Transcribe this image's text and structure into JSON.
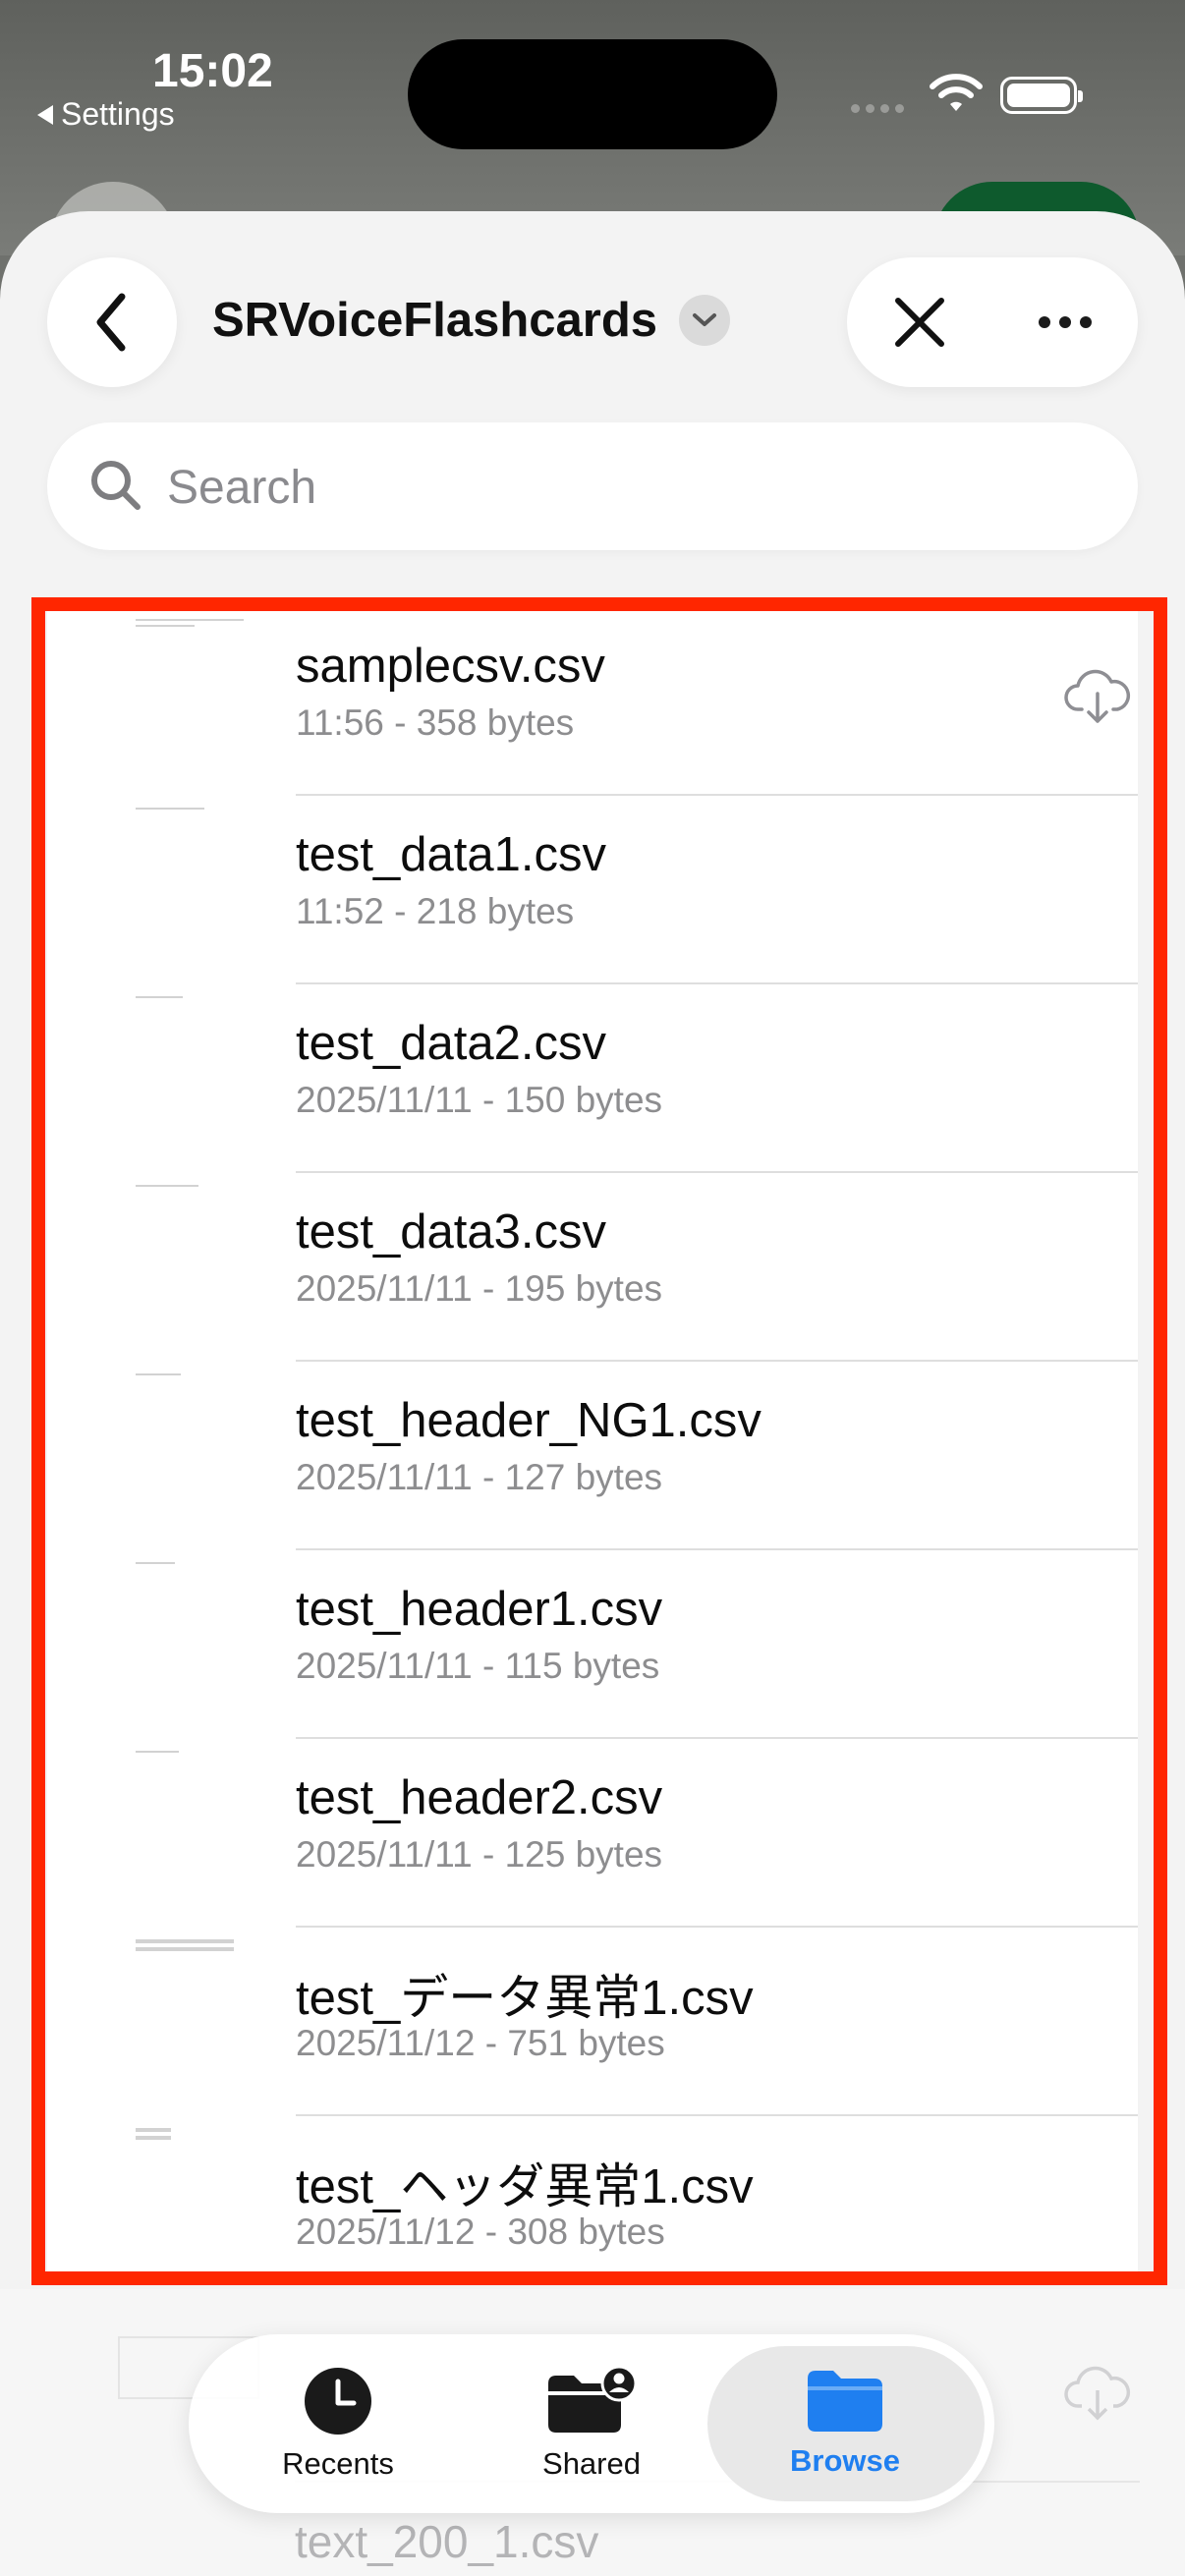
{
  "status_bar": {
    "time": "15:02",
    "back_label": "Settings"
  },
  "header": {
    "title": "SRVoiceFlashcards"
  },
  "search": {
    "placeholder": "Search",
    "value": ""
  },
  "files": [
    {
      "name": "samplecsv.csv",
      "meta": "11:56 - 358 bytes",
      "cloud": true
    },
    {
      "name": "test_data1.csv",
      "meta": "11:52 - 218 bytes",
      "cloud": false
    },
    {
      "name": "test_data2.csv",
      "meta": "2025/11/11 - 150 bytes",
      "cloud": false
    },
    {
      "name": "test_data3.csv",
      "meta": "2025/11/11 - 195 bytes",
      "cloud": false
    },
    {
      "name": "test_header_NG1.csv",
      "meta": "2025/11/11 - 127 bytes",
      "cloud": false
    },
    {
      "name": "test_header1.csv",
      "meta": "2025/11/11 - 115 bytes",
      "cloud": false
    },
    {
      "name": "test_header2.csv",
      "meta": "2025/11/11 - 125 bytes",
      "cloud": false
    },
    {
      "name": "test_データ異常1.csv",
      "meta": "2025/11/12 - 751 bytes",
      "cloud": false
    },
    {
      "name": "test_ヘッダ異常1.csv",
      "meta": "2025/11/12 - 308 bytes",
      "cloud": false
    }
  ],
  "partially_hidden_file": {
    "name": "text_200_1.csv"
  },
  "tabs": [
    {
      "label": "Recents",
      "icon": "clock-icon",
      "active": false
    },
    {
      "label": "Shared",
      "icon": "shared-folder-icon",
      "active": false
    },
    {
      "label": "Browse",
      "icon": "folder-icon",
      "active": true
    }
  ],
  "colors": {
    "accent": "#1f7ff0",
    "highlight_border": "#ff2600"
  }
}
